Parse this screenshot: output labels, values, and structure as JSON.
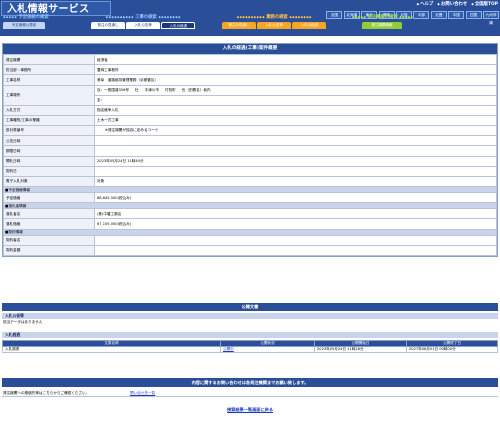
{
  "header": {
    "app_title": "入札情報サービス",
    "top_links": [
      "ヘルプ",
      "お問い合わせ",
      "全国版TOP"
    ],
    "regions": [
      "全国",
      "北海道",
      "東北",
      "関東",
      "北陸",
      "中部",
      "近畿",
      "中国",
      "四国",
      "九州沖縄"
    ],
    "nav_groups": [
      {
        "title": "予定価格の検索",
        "buttons": [
          {
            "label": "予定価格公表前",
            "style": "light"
          }
        ]
      },
      {
        "title": "工事の検索",
        "buttons": [
          {
            "label": "発注の見通し",
            "style": "blue"
          },
          {
            "label": "入札公告等",
            "style": "blue"
          },
          {
            "label": "入札の経過",
            "style": "active"
          }
        ]
      },
      {
        "title": "業務の検索",
        "buttons": [
          {
            "label": "発注の見通し",
            "style": "orange"
          },
          {
            "label": "入札公告等",
            "style": "orange"
          },
          {
            "label": "入札の経過",
            "style": "orange"
          }
        ]
      },
      {
        "title": "発注機関の検索",
        "buttons": [
          {
            "label": "発注機関情報",
            "style": "green"
          }
        ]
      }
    ]
  },
  "main": {
    "panel_title": "入札の経過(工事)案件概要",
    "rows": [
      {
        "label": "発注機関",
        "value": "経済省"
      },
      {
        "label": "担当部・事務所",
        "value": "豊岡工事務所"
      },
      {
        "label": "工事名称",
        "value": "美幸　道路維持管理業務（京都管区）"
      },
      {
        "label": "入札方式",
        "value": "指名競争入札"
      },
      {
        "label": "工事種別/工事の業種",
        "value": "土木一式工事"
      },
      {
        "label": "設計書番号",
        "value": "※発注機関が独自に定めるコード"
      },
      {
        "label": "公告日時",
        "value": ""
      },
      {
        "label": "期限日時",
        "value": ""
      },
      {
        "label": "開札日時",
        "value": "2023年05月24日 11時40分"
      },
      {
        "label": "契約日",
        "value": ""
      },
      {
        "label": "電子入札対象",
        "value": "対象"
      }
    ],
    "location": {
      "label": "工事場所",
      "line1": [
        "自：一般国道356号",
        "杜",
        "中津川市",
        "付知町",
        "也（田養名）坂内"
      ],
      "line2": "至："
    },
    "sections": {
      "estimate": "■予定価格情報",
      "winner": "■落札者情報",
      "contract": "■契約情報"
    },
    "estimate_rows": [
      {
        "label": "予定価格",
        "value": "88,645,500(税込み)"
      }
    ],
    "winner_rows": [
      {
        "label": "落札者名",
        "value": "(株)中農工務店"
      },
      {
        "label": "落札価格",
        "value": "67,155,000(税込み)"
      }
    ],
    "contract_rows": [
      {
        "label": "契約者名",
        "value": ""
      },
      {
        "label": "契約金額",
        "value": ""
      }
    ]
  },
  "public_docs": {
    "title": "公開文書",
    "notice_head": "入札公告等",
    "notice_empty": "該当データはありません",
    "history_head": "入札経過",
    "columns": [
      "文書名称",
      "公開状況",
      "公開開始日",
      "公開終了日"
    ],
    "rows": [
      {
        "name": "入札調書",
        "status": "公開中",
        "start": "2023年05月24日 11時26分",
        "end": "2027年06月01日 00時00分"
      }
    ]
  },
  "contact": {
    "title": "内容に関するお問い合わせは各発注機関までお願い致します。",
    "text": "発注機関への連絡先等はこちらからご確認ください。",
    "link": "問い合せ先一覧"
  },
  "footer": {
    "back_link": "検索結果一覧画面に戻る"
  }
}
